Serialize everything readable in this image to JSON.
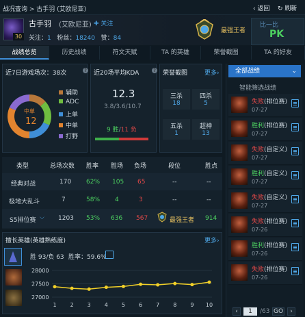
{
  "topbar": {
    "breadcrumb": "战况查询 > 古手羽 (艾欧尼亚)",
    "back_label": "返回",
    "refresh_label": "刷新"
  },
  "profile": {
    "level": "30",
    "name": "古手羽",
    "server": "(艾欧尼亚)",
    "follow_label": "关注",
    "stats_follow_label": "关注：",
    "stats_follow_value": "1",
    "stats_fans_label": "粉丝：",
    "stats_fans_value": "18240",
    "stats_likes_label": "赞：",
    "stats_likes_value": "84",
    "rank": "最强王者",
    "compare_label": "比一比",
    "pk_label": "PK"
  },
  "tabs": [
    "战绩总览",
    "历史战绩",
    "符文天赋",
    "TA 的英雄",
    "荣誉截图",
    "TA 的好友"
  ],
  "recent7": {
    "title": "近7日游戏场次：38次",
    "center_role": "中单",
    "center_count": "12",
    "legend": [
      "辅助",
      "ADC",
      "上单",
      "中单",
      "打野"
    ],
    "legend_colors": [
      "#b8783a",
      "#6fbd40",
      "#3f8fd8",
      "#e2842f",
      "#8a6ad0"
    ],
    "values": [
      5,
      7,
      7,
      12,
      7
    ]
  },
  "kda": {
    "title": "近20场平均KDA",
    "value": "12.3",
    "detail": "3.8/3.6/10.7",
    "wins": "9 胜",
    "sep": "/",
    "losses": "11 负",
    "win_fraction": 0.45
  },
  "honor": {
    "title": "荣誉截图",
    "more_label": "更多",
    "cells": [
      {
        "label": "三杀",
        "value": "18"
      },
      {
        "label": "四杀",
        "value": "5"
      },
      {
        "label": "五杀",
        "value": "1"
      },
      {
        "label": "超神",
        "value": "13"
      }
    ]
  },
  "table": {
    "headers": [
      "类型",
      "总场次数",
      "胜率",
      "胜场",
      "负场",
      "段位",
      "胜点"
    ],
    "rows": [
      {
        "type": "经典对战",
        "total": "170",
        "rate": "62%",
        "wins": "105",
        "losses": "65",
        "rank": "--",
        "points": "--"
      },
      {
        "type": "极地大乱斗",
        "total": "7",
        "rate": "58%",
        "wins": "4",
        "losses": "3",
        "rank": "--",
        "points": "--"
      },
      {
        "type": "S5排位赛",
        "total": "1203",
        "rate": "53%",
        "wins": "636",
        "losses": "567",
        "rank": "最强王者",
        "points": "914"
      }
    ]
  },
  "hero": {
    "title": "擅长英雄(英雄熟练度)",
    "more_label": "更多",
    "record": "胜 93/负 63",
    "winrate": "胜率：59.6%"
  },
  "chart_data": {
    "type": "line",
    "x": [
      1,
      2,
      3,
      4,
      5,
      6,
      7,
      8,
      9,
      10
    ],
    "series": [
      {
        "values": [
          27390,
          27330,
          27300,
          27370,
          27400,
          27480,
          27460,
          27510,
          27470,
          27560
        ]
      }
    ],
    "yticks": [
      "28000",
      "27500",
      "27000"
    ],
    "ylim": [
      27000,
      28000
    ],
    "xlabels": [
      "1",
      "2",
      "3",
      "4",
      "5",
      "6",
      "7",
      "8",
      "9",
      "10"
    ],
    "line_color": "#f2d028"
  },
  "sidebar": {
    "all_label": "全部战绩",
    "smart_label": "智能筛选战绩",
    "matches": [
      {
        "result": "失败",
        "mode": "(排位赛)",
        "date": "07-27"
      },
      {
        "result": "胜利",
        "mode": "(排位赛)",
        "date": "07-27"
      },
      {
        "result": "失败",
        "mode": "(自定义)",
        "date": "07-27"
      },
      {
        "result": "胜利",
        "mode": "(自定义)",
        "date": "07-27"
      },
      {
        "result": "失败",
        "mode": "(自定义)",
        "date": "07-27"
      },
      {
        "result": "失败",
        "mode": "(排位赛)",
        "date": "07-26"
      },
      {
        "result": "胜利",
        "mode": "(排位赛)",
        "date": "07-26"
      },
      {
        "result": "失败",
        "mode": "(排位赛)",
        "date": "07-26"
      }
    ],
    "page_current": "1",
    "page_total": "/63",
    "go_label": "GO"
  }
}
